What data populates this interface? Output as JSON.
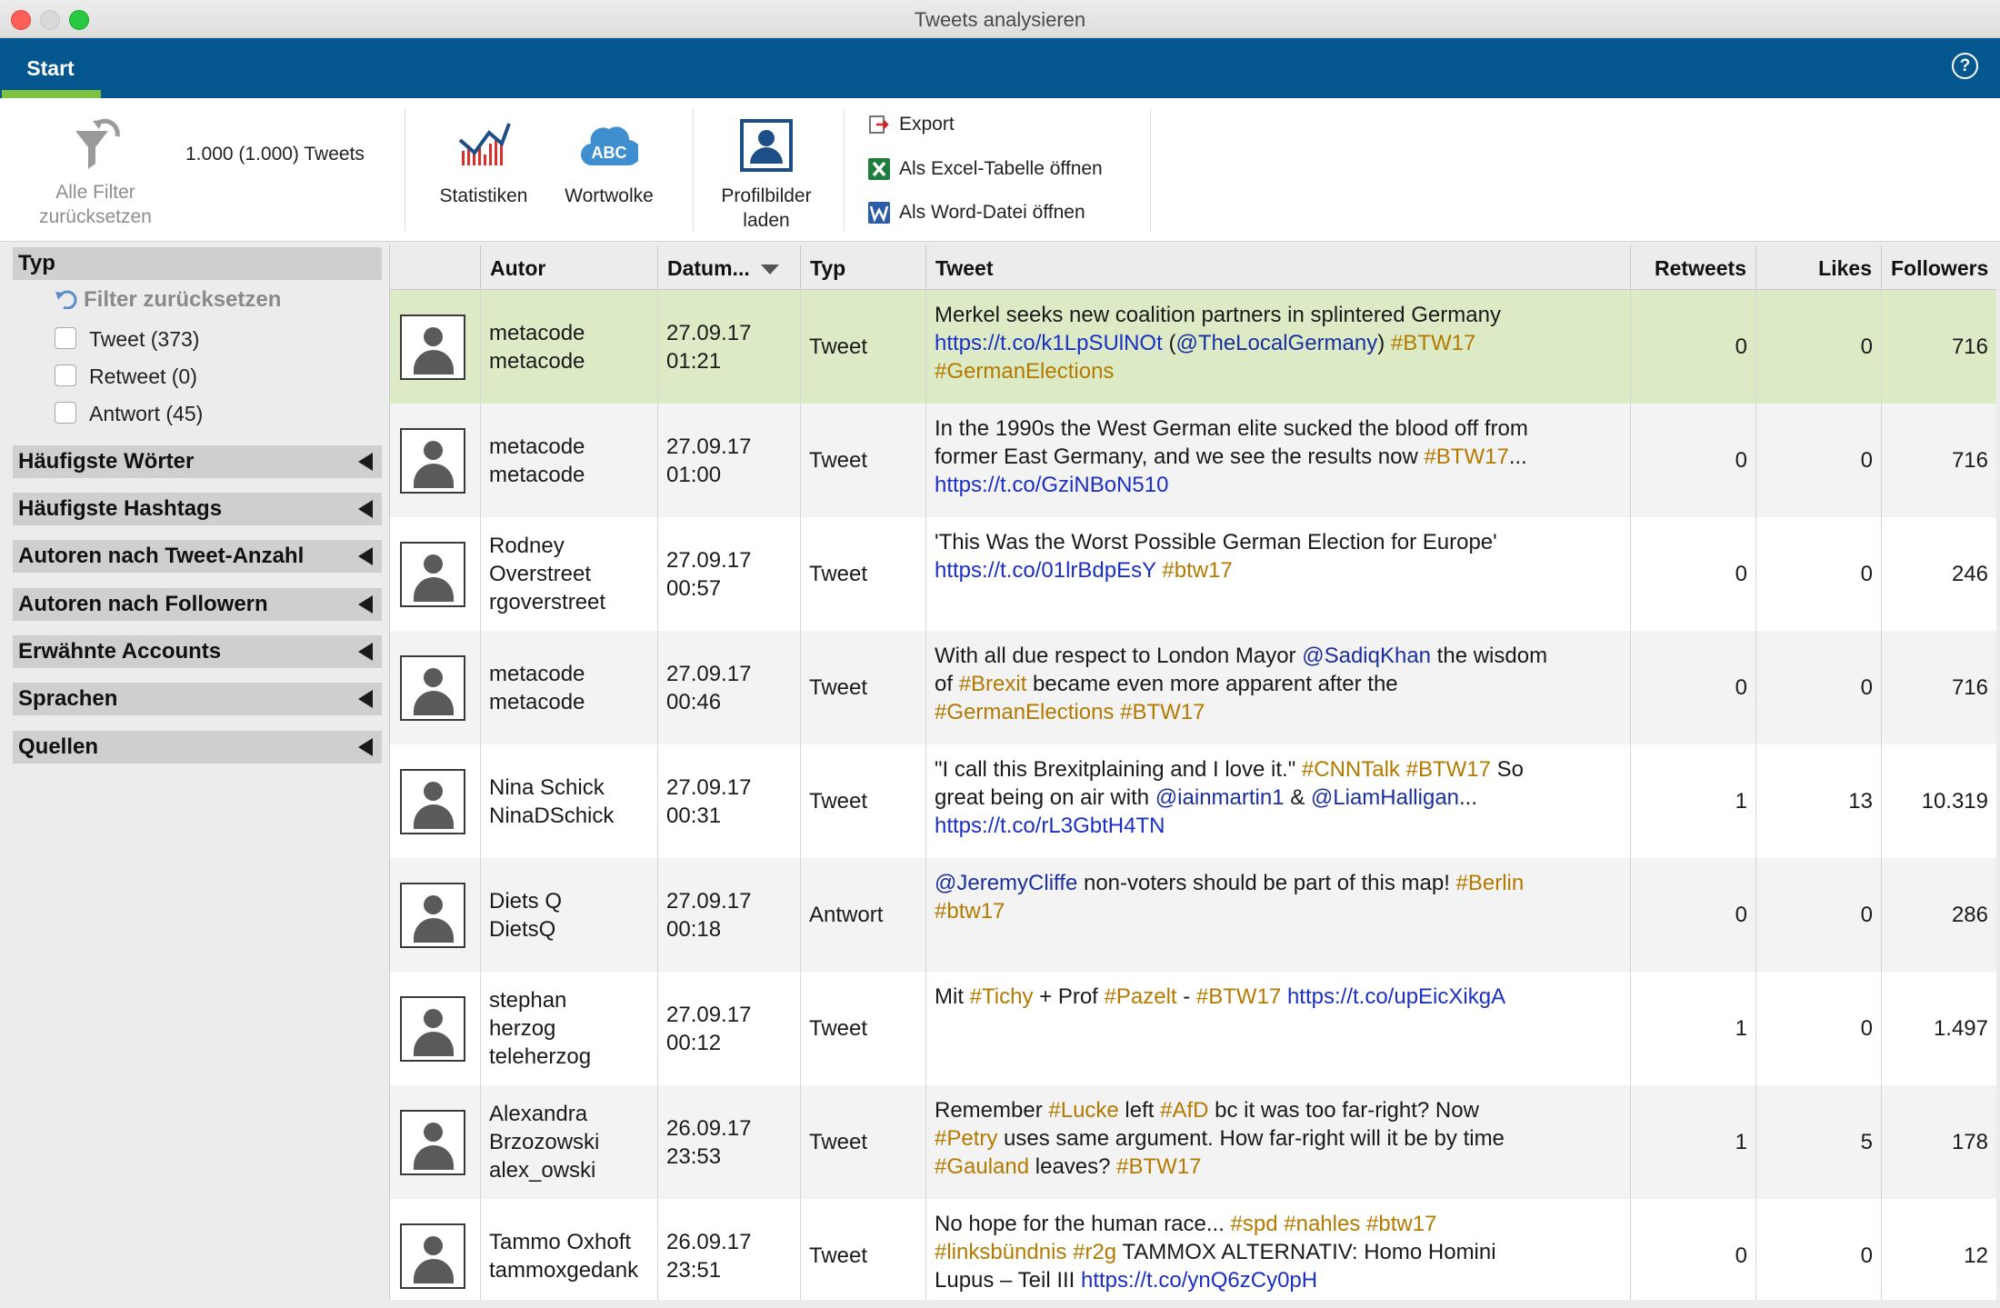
{
  "window": {
    "title": "Tweets analysieren"
  },
  "ribbon": {
    "tab": "Start",
    "help": "?"
  },
  "toolbar": {
    "reset_filters": [
      "Alle Filter",
      "zurücksetzen"
    ],
    "count": "1.000 (1.000) Tweets",
    "stats": "Statistiken",
    "wordcloud": "Wortwolke",
    "wordcloud_icon_text": "ABC",
    "profile": [
      "Profilbilder",
      "laden"
    ],
    "export": "Export",
    "excel": "Als Excel-Tabelle öffnen",
    "word": "Als Word-Datei öffnen"
  },
  "sidebar": {
    "type_header": "Typ",
    "reset": "Filter zurücksetzen",
    "checks": [
      "Tweet (373)",
      "Retweet (0)",
      "Antwort (45)"
    ],
    "sections": [
      "Häufigste Wörter",
      "Häufigste Hashtags",
      "Autoren nach Tweet-Anzahl",
      "Autoren nach Followern",
      "Erwähnte Accounts",
      "Sprachen",
      "Quellen"
    ]
  },
  "table": {
    "headers": {
      "autor": "Autor",
      "datum": "Datum...",
      "typ": "Typ",
      "tweet": "Tweet",
      "retweets": "Retweets",
      "likes": "Likes",
      "followers": "Followers"
    },
    "rows": [
      {
        "author": [
          "metacode",
          "metacode"
        ],
        "date": [
          "27.09.17",
          "01:21"
        ],
        "type": "Tweet",
        "tweet": [
          [
            [
              "t",
              "Merkel seeks new coalition partners in splintered Germany"
            ]
          ],
          [
            [
              "l",
              "https://t.co/k1LpSUlNOt"
            ],
            [
              "t",
              " ("
            ],
            [
              "m",
              "@TheLocalGermany"
            ],
            [
              "t",
              ") "
            ],
            [
              "h",
              "#BTW17"
            ]
          ],
          [
            [
              "h",
              "#GermanElections"
            ]
          ]
        ],
        "retweets": "0",
        "likes": "0",
        "followers": "716"
      },
      {
        "author": [
          "metacode",
          "metacode"
        ],
        "date": [
          "27.09.17",
          "01:00"
        ],
        "type": "Tweet",
        "tweet": [
          [
            [
              "t",
              "In the 1990s the West German elite sucked the blood off from"
            ]
          ],
          [
            [
              "t",
              "former East Germany, and we see the results now "
            ],
            [
              "h",
              "#BTW17"
            ],
            [
              "t",
              "..."
            ]
          ],
          [
            [
              "l",
              "https://t.co/GziNBoN510"
            ]
          ]
        ],
        "retweets": "0",
        "likes": "0",
        "followers": "716"
      },
      {
        "author": [
          "Rodney",
          "Overstreet",
          "rgoverstreet"
        ],
        "date": [
          "27.09.17",
          "00:57"
        ],
        "type": "Tweet",
        "tweet": [
          [
            [
              "t",
              "'This Was the Worst Possible German Election for Europe'"
            ]
          ],
          [
            [
              "l",
              "https://t.co/01lrBdpEsY"
            ],
            [
              "t",
              " "
            ],
            [
              "h",
              "#btw17"
            ]
          ]
        ],
        "retweets": "0",
        "likes": "0",
        "followers": "246"
      },
      {
        "author": [
          "metacode",
          "metacode"
        ],
        "date": [
          "27.09.17",
          "00:46"
        ],
        "type": "Tweet",
        "tweet": [
          [
            [
              "t",
              "With all due respect to London Mayor "
            ],
            [
              "m",
              "@SadiqKhan"
            ],
            [
              "t",
              " the wisdom"
            ]
          ],
          [
            [
              "t",
              "of "
            ],
            [
              "h",
              "#Brexit"
            ],
            [
              "t",
              " became even more apparent after the"
            ]
          ],
          [
            [
              "h",
              "#GermanElections"
            ],
            [
              "t",
              " "
            ],
            [
              "h",
              "#BTW17"
            ]
          ]
        ],
        "retweets": "0",
        "likes": "0",
        "followers": "716"
      },
      {
        "author": [
          "Nina Schick",
          "NinaDSchick"
        ],
        "date": [
          "27.09.17",
          "00:31"
        ],
        "type": "Tweet",
        "tweet": [
          [
            [
              "t",
              "\"I call this Brexitplaining and I love it.\" "
            ],
            [
              "h",
              "#CNNTalk"
            ],
            [
              "t",
              " "
            ],
            [
              "h",
              "#BTW17"
            ],
            [
              "t",
              " So"
            ]
          ],
          [
            [
              "t",
              "great being on air with "
            ],
            [
              "m",
              "@iainmartin1"
            ],
            [
              "t",
              " & "
            ],
            [
              "m",
              "@LiamHalligan"
            ],
            [
              "t",
              "..."
            ]
          ],
          [
            [
              "l",
              "https://t.co/rL3GbtH4TN"
            ]
          ]
        ],
        "retweets": "1",
        "likes": "13",
        "followers": "10.319"
      },
      {
        "author": [
          "Diets Q",
          "DietsQ"
        ],
        "date": [
          "27.09.17",
          "00:18"
        ],
        "type": "Antwort",
        "tweet": [
          [
            [
              "m",
              "@JeremyCliffe"
            ],
            [
              "t",
              " non-voters should be part of this map! "
            ],
            [
              "h",
              "#Berlin"
            ]
          ],
          [
            [
              "h",
              "#btw17"
            ]
          ]
        ],
        "retweets": "0",
        "likes": "0",
        "followers": "286"
      },
      {
        "author": [
          "stephan",
          "herzog",
          "teleherzog"
        ],
        "date": [
          "27.09.17",
          "00:12"
        ],
        "type": "Tweet",
        "tweet": [
          [
            [
              "t",
              "Mit "
            ],
            [
              "h",
              "#Tichy"
            ],
            [
              "t",
              " + Prof "
            ],
            [
              "h",
              "#Pazelt"
            ],
            [
              "t",
              " - "
            ],
            [
              "h",
              "#BTW17"
            ],
            [
              "t",
              " "
            ],
            [
              "l",
              "https://t.co/upEicXikgA"
            ]
          ]
        ],
        "retweets": "1",
        "likes": "0",
        "followers": "1.497"
      },
      {
        "author": [
          "Alexandra",
          "Brzozowski",
          "alex_owski"
        ],
        "date": [
          "26.09.17",
          "23:53"
        ],
        "type": "Tweet",
        "tweet": [
          [
            [
              "t",
              "Remember "
            ],
            [
              "h",
              "#Lucke"
            ],
            [
              "t",
              " left "
            ],
            [
              "h",
              "#AfD"
            ],
            [
              "t",
              " bc it was too far-right? Now"
            ]
          ],
          [
            [
              "h",
              "#Petry"
            ],
            [
              "t",
              " uses same argument. How far-right will it be by time"
            ]
          ],
          [
            [
              "h",
              "#Gauland"
            ],
            [
              "t",
              " leaves? "
            ],
            [
              "h",
              "#BTW17"
            ]
          ]
        ],
        "retweets": "1",
        "likes": "5",
        "followers": "178"
      },
      {
        "author": [
          "Tammo Oxhoft",
          "tammoxgedank"
        ],
        "date": [
          "26.09.17",
          "23:51"
        ],
        "type": "Tweet",
        "tweet": [
          [
            [
              "t",
              "No hope for the human race... "
            ],
            [
              "h",
              "#spd"
            ],
            [
              "t",
              " "
            ],
            [
              "h",
              "#nahles"
            ],
            [
              "t",
              " "
            ],
            [
              "h",
              "#btw17"
            ]
          ],
          [
            [
              "h",
              "#linksbündnis"
            ],
            [
              "t",
              " "
            ],
            [
              "h",
              "#r2g"
            ],
            [
              "t",
              " TAMMOX ALTERNATIV: Homo Homini"
            ]
          ],
          [
            [
              "t",
              "Lupus – Teil III "
            ],
            [
              "l",
              "https://t.co/ynQ6zCy0pH"
            ]
          ]
        ],
        "retweets": "0",
        "likes": "0",
        "followers": "12"
      }
    ]
  },
  "colors": {
    "ribbon": "#04568e",
    "accent": "#7ec242",
    "selected_row": "#dcebc6",
    "link": "#1b2fc4",
    "hashtag": "#b47a00"
  },
  "icons": [
    "filter-reset-icon",
    "statistics-icon",
    "wordcloud-icon",
    "profile-picture-icon",
    "export-icon",
    "excel-icon",
    "word-icon",
    "help-icon",
    "undo-icon",
    "avatar-icon"
  ]
}
